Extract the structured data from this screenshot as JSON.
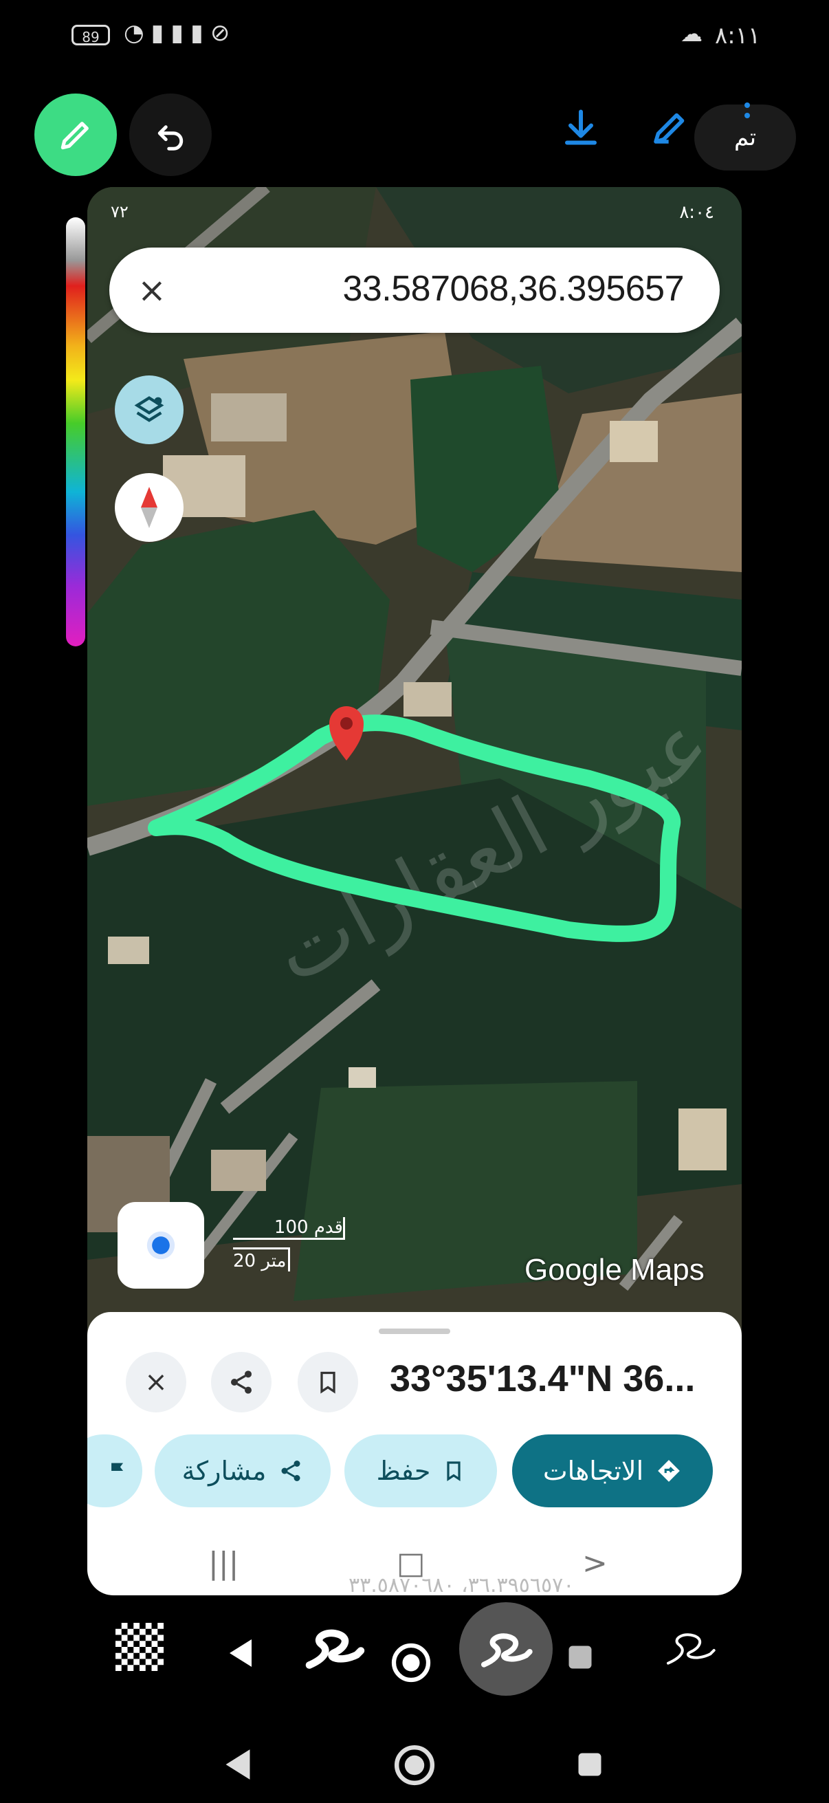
{
  "status_bar": {
    "battery": "89",
    "clock": "٨:١١"
  },
  "editor": {
    "done_label": "تم"
  },
  "inner_status": {
    "time": "٨:٠٤",
    "left": "٧٢"
  },
  "search": {
    "query": "33.587068,36.395657"
  },
  "map": {
    "scale_km": "100 قدم",
    "scale_m": "20 متر",
    "logo": "Google Maps",
    "watermark": "عبور العقارات",
    "highlight_color": "#3ef0a0",
    "pin_color": "#e53935"
  },
  "sheet": {
    "title": "33°35'13.4\"N 36...",
    "directions": "الاتجاهات",
    "save": "حفظ",
    "share": "مشاركة",
    "peek_text": "٣٦.٣٩٥٦٥٧٠، ٣٣.٥٨٧٠٦٨٠"
  },
  "colors": {
    "accent_green": "#3ddc84",
    "maps_teal": "#0e7285",
    "chip_bg": "#c9eef6"
  }
}
